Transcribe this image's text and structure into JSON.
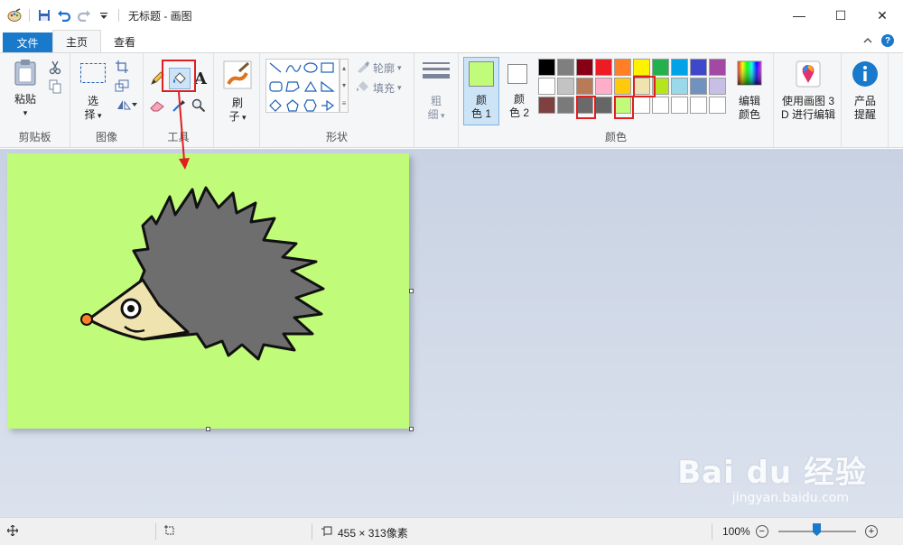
{
  "window": {
    "title": "无标题 - 画图",
    "minimize_glyph": "—",
    "maximize_glyph": "☐",
    "close_glyph": "✕"
  },
  "tabs": {
    "file": "文件",
    "home": "主页",
    "view": "查看"
  },
  "clipboard": {
    "paste": "粘贴",
    "paste_arrow": "▾",
    "label": "剪贴板"
  },
  "image": {
    "select_line1": "选",
    "select_line2": "择",
    "label": "图像"
  },
  "tools": {
    "label": "工具",
    "text_glyph": "A"
  },
  "brushes": {
    "line1": "刷",
    "line2": "子"
  },
  "shapes": {
    "outline": "轮廓",
    "fill": "填充",
    "label": "形状"
  },
  "size": {
    "line1": "粗",
    "line2": "细"
  },
  "colors": {
    "color1_line1": "颜",
    "color1_line2": "色 1",
    "color2_line1": "颜",
    "color2_line2": "色 2",
    "color1_value": "#c0fb7a",
    "color2_value": "#ffffff",
    "edit_line1": "编辑",
    "edit_line2": "颜色",
    "label": "颜色",
    "palette_row1": [
      "#000000",
      "#7f7f7f",
      "#880015",
      "#ed1c24",
      "#ff7f27",
      "#fff200",
      "#22b14c",
      "#00a2e8",
      "#3f48cc",
      "#a349a4"
    ],
    "palette_row2": [
      "#ffffff",
      "#c3c3c3",
      "#b97a57",
      "#ffaec9",
      "#ffc90e",
      "#efe4b0",
      "#b5e61d",
      "#99d9ea",
      "#7092be",
      "#c8bfe7"
    ],
    "palette_row3": [
      "#7f4040",
      "#7a7a7a",
      "#6a6a6a",
      "#666666",
      "#c0fb7a",
      "#ffffff",
      "#ffffff",
      "#ffffff",
      "#ffffff",
      "#ffffff"
    ]
  },
  "paint3d": {
    "line1": "使用画图 3",
    "line2": "D 进行编辑"
  },
  "product": {
    "line1": "产品",
    "line2": "提醒"
  },
  "status": {
    "dimensions": "455 × 313像素",
    "zoom": "100%"
  },
  "watermark": {
    "main": "Bai du 经验",
    "sub": "jingyan.baidu.com"
  }
}
